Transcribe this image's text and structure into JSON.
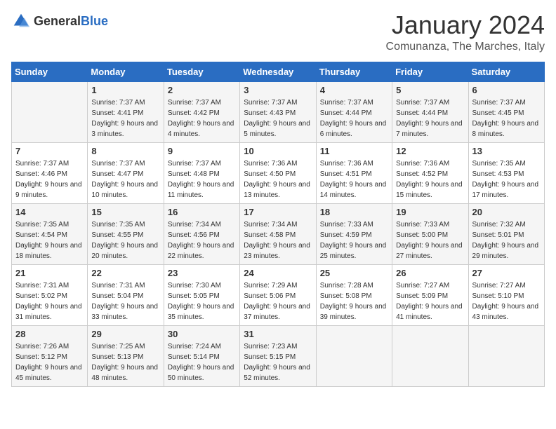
{
  "header": {
    "logo_general": "General",
    "logo_blue": "Blue",
    "month_title": "January 2024",
    "location": "Comunanza, The Marches, Italy"
  },
  "columns": [
    "Sunday",
    "Monday",
    "Tuesday",
    "Wednesday",
    "Thursday",
    "Friday",
    "Saturday"
  ],
  "weeks": [
    [
      {
        "day": "",
        "sunrise": "",
        "sunset": "",
        "daylight": ""
      },
      {
        "day": "1",
        "sunrise": "Sunrise: 7:37 AM",
        "sunset": "Sunset: 4:41 PM",
        "daylight": "Daylight: 9 hours and 3 minutes."
      },
      {
        "day": "2",
        "sunrise": "Sunrise: 7:37 AM",
        "sunset": "Sunset: 4:42 PM",
        "daylight": "Daylight: 9 hours and 4 minutes."
      },
      {
        "day": "3",
        "sunrise": "Sunrise: 7:37 AM",
        "sunset": "Sunset: 4:43 PM",
        "daylight": "Daylight: 9 hours and 5 minutes."
      },
      {
        "day": "4",
        "sunrise": "Sunrise: 7:37 AM",
        "sunset": "Sunset: 4:44 PM",
        "daylight": "Daylight: 9 hours and 6 minutes."
      },
      {
        "day": "5",
        "sunrise": "Sunrise: 7:37 AM",
        "sunset": "Sunset: 4:44 PM",
        "daylight": "Daylight: 9 hours and 7 minutes."
      },
      {
        "day": "6",
        "sunrise": "Sunrise: 7:37 AM",
        "sunset": "Sunset: 4:45 PM",
        "daylight": "Daylight: 9 hours and 8 minutes."
      }
    ],
    [
      {
        "day": "7",
        "sunrise": "Sunrise: 7:37 AM",
        "sunset": "Sunset: 4:46 PM",
        "daylight": "Daylight: 9 hours and 9 minutes."
      },
      {
        "day": "8",
        "sunrise": "Sunrise: 7:37 AM",
        "sunset": "Sunset: 4:47 PM",
        "daylight": "Daylight: 9 hours and 10 minutes."
      },
      {
        "day": "9",
        "sunrise": "Sunrise: 7:37 AM",
        "sunset": "Sunset: 4:48 PM",
        "daylight": "Daylight: 9 hours and 11 minutes."
      },
      {
        "day": "10",
        "sunrise": "Sunrise: 7:36 AM",
        "sunset": "Sunset: 4:50 PM",
        "daylight": "Daylight: 9 hours and 13 minutes."
      },
      {
        "day": "11",
        "sunrise": "Sunrise: 7:36 AM",
        "sunset": "Sunset: 4:51 PM",
        "daylight": "Daylight: 9 hours and 14 minutes."
      },
      {
        "day": "12",
        "sunrise": "Sunrise: 7:36 AM",
        "sunset": "Sunset: 4:52 PM",
        "daylight": "Daylight: 9 hours and 15 minutes."
      },
      {
        "day": "13",
        "sunrise": "Sunrise: 7:35 AM",
        "sunset": "Sunset: 4:53 PM",
        "daylight": "Daylight: 9 hours and 17 minutes."
      }
    ],
    [
      {
        "day": "14",
        "sunrise": "Sunrise: 7:35 AM",
        "sunset": "Sunset: 4:54 PM",
        "daylight": "Daylight: 9 hours and 18 minutes."
      },
      {
        "day": "15",
        "sunrise": "Sunrise: 7:35 AM",
        "sunset": "Sunset: 4:55 PM",
        "daylight": "Daylight: 9 hours and 20 minutes."
      },
      {
        "day": "16",
        "sunrise": "Sunrise: 7:34 AM",
        "sunset": "Sunset: 4:56 PM",
        "daylight": "Daylight: 9 hours and 22 minutes."
      },
      {
        "day": "17",
        "sunrise": "Sunrise: 7:34 AM",
        "sunset": "Sunset: 4:58 PM",
        "daylight": "Daylight: 9 hours and 23 minutes."
      },
      {
        "day": "18",
        "sunrise": "Sunrise: 7:33 AM",
        "sunset": "Sunset: 4:59 PM",
        "daylight": "Daylight: 9 hours and 25 minutes."
      },
      {
        "day": "19",
        "sunrise": "Sunrise: 7:33 AM",
        "sunset": "Sunset: 5:00 PM",
        "daylight": "Daylight: 9 hours and 27 minutes."
      },
      {
        "day": "20",
        "sunrise": "Sunrise: 7:32 AM",
        "sunset": "Sunset: 5:01 PM",
        "daylight": "Daylight: 9 hours and 29 minutes."
      }
    ],
    [
      {
        "day": "21",
        "sunrise": "Sunrise: 7:31 AM",
        "sunset": "Sunset: 5:02 PM",
        "daylight": "Daylight: 9 hours and 31 minutes."
      },
      {
        "day": "22",
        "sunrise": "Sunrise: 7:31 AM",
        "sunset": "Sunset: 5:04 PM",
        "daylight": "Daylight: 9 hours and 33 minutes."
      },
      {
        "day": "23",
        "sunrise": "Sunrise: 7:30 AM",
        "sunset": "Sunset: 5:05 PM",
        "daylight": "Daylight: 9 hours and 35 minutes."
      },
      {
        "day": "24",
        "sunrise": "Sunrise: 7:29 AM",
        "sunset": "Sunset: 5:06 PM",
        "daylight": "Daylight: 9 hours and 37 minutes."
      },
      {
        "day": "25",
        "sunrise": "Sunrise: 7:28 AM",
        "sunset": "Sunset: 5:08 PM",
        "daylight": "Daylight: 9 hours and 39 minutes."
      },
      {
        "day": "26",
        "sunrise": "Sunrise: 7:27 AM",
        "sunset": "Sunset: 5:09 PM",
        "daylight": "Daylight: 9 hours and 41 minutes."
      },
      {
        "day": "27",
        "sunrise": "Sunrise: 7:27 AM",
        "sunset": "Sunset: 5:10 PM",
        "daylight": "Daylight: 9 hours and 43 minutes."
      }
    ],
    [
      {
        "day": "28",
        "sunrise": "Sunrise: 7:26 AM",
        "sunset": "Sunset: 5:12 PM",
        "daylight": "Daylight: 9 hours and 45 minutes."
      },
      {
        "day": "29",
        "sunrise": "Sunrise: 7:25 AM",
        "sunset": "Sunset: 5:13 PM",
        "daylight": "Daylight: 9 hours and 48 minutes."
      },
      {
        "day": "30",
        "sunrise": "Sunrise: 7:24 AM",
        "sunset": "Sunset: 5:14 PM",
        "daylight": "Daylight: 9 hours and 50 minutes."
      },
      {
        "day": "31",
        "sunrise": "Sunrise: 7:23 AM",
        "sunset": "Sunset: 5:15 PM",
        "daylight": "Daylight: 9 hours and 52 minutes."
      },
      {
        "day": "",
        "sunrise": "",
        "sunset": "",
        "daylight": ""
      },
      {
        "day": "",
        "sunrise": "",
        "sunset": "",
        "daylight": ""
      },
      {
        "day": "",
        "sunrise": "",
        "sunset": "",
        "daylight": ""
      }
    ]
  ]
}
